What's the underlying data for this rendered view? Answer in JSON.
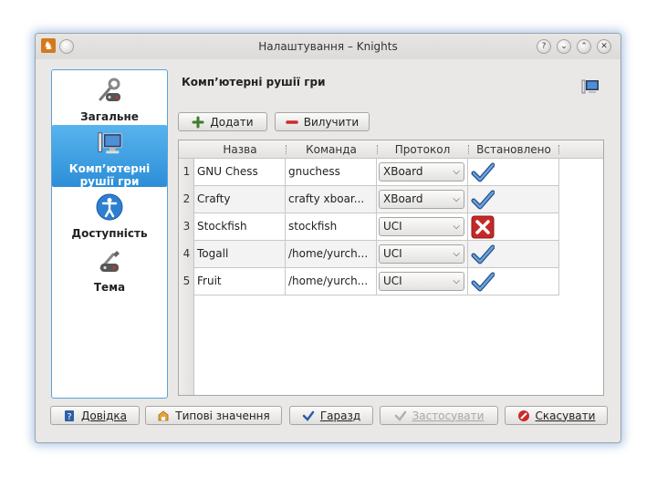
{
  "window": {
    "title": "Налаштування – Knights",
    "app_icon": "knight-app-icon"
  },
  "titlebar_buttons": [
    {
      "name": "help-icon",
      "glyph": "?"
    },
    {
      "name": "minimize-icon",
      "glyph": "⌄"
    },
    {
      "name": "maximize-icon",
      "glyph": "⌃"
    },
    {
      "name": "close-icon",
      "glyph": "✕"
    }
  ],
  "sidebar": {
    "items": [
      {
        "label": "Загальне",
        "icon": "general-settings-icon",
        "active": false
      },
      {
        "label": "Комп’ютерні рушії гри",
        "icon": "computer-engines-icon",
        "active": true
      },
      {
        "label": "Доступність",
        "icon": "accessibility-icon",
        "active": false
      },
      {
        "label": "Тема",
        "icon": "theme-icon",
        "active": false
      }
    ]
  },
  "page": {
    "heading": "Комп’ютерні рушії гри",
    "heading_icon": "monitor-icon"
  },
  "toolbar": {
    "add_label": "Додати",
    "remove_label": "Вилучити"
  },
  "table": {
    "columns": [
      "Назва",
      "Команда",
      "Протокол",
      "Встановлено"
    ],
    "rows": [
      {
        "num": "1",
        "name": "GNU Chess",
        "command": "gnuchess",
        "protocol": "XBoard",
        "installed": true
      },
      {
        "num": "2",
        "name": "Crafty",
        "command": "crafty xboar...",
        "protocol": "XBoard",
        "installed": true
      },
      {
        "num": "3",
        "name": "Stockfish",
        "command": "stockfish",
        "protocol": "UCI",
        "installed": false
      },
      {
        "num": "4",
        "name": "Togall",
        "command": "/home/yurch...",
        "protocol": "UCI",
        "installed": true
      },
      {
        "num": "5",
        "name": "Fruit",
        "command": "/home/yurch...",
        "protocol": "UCI",
        "installed": true
      }
    ]
  },
  "footer": {
    "help_label": "Довідка",
    "defaults_label": "Типові значення",
    "ok_label": "Гаразд",
    "apply_label": "Застосувати",
    "cancel_label": "Скасувати"
  },
  "colors": {
    "accent": "#2c8ed8",
    "check": "#3a6fb0",
    "error": "#c62828"
  }
}
